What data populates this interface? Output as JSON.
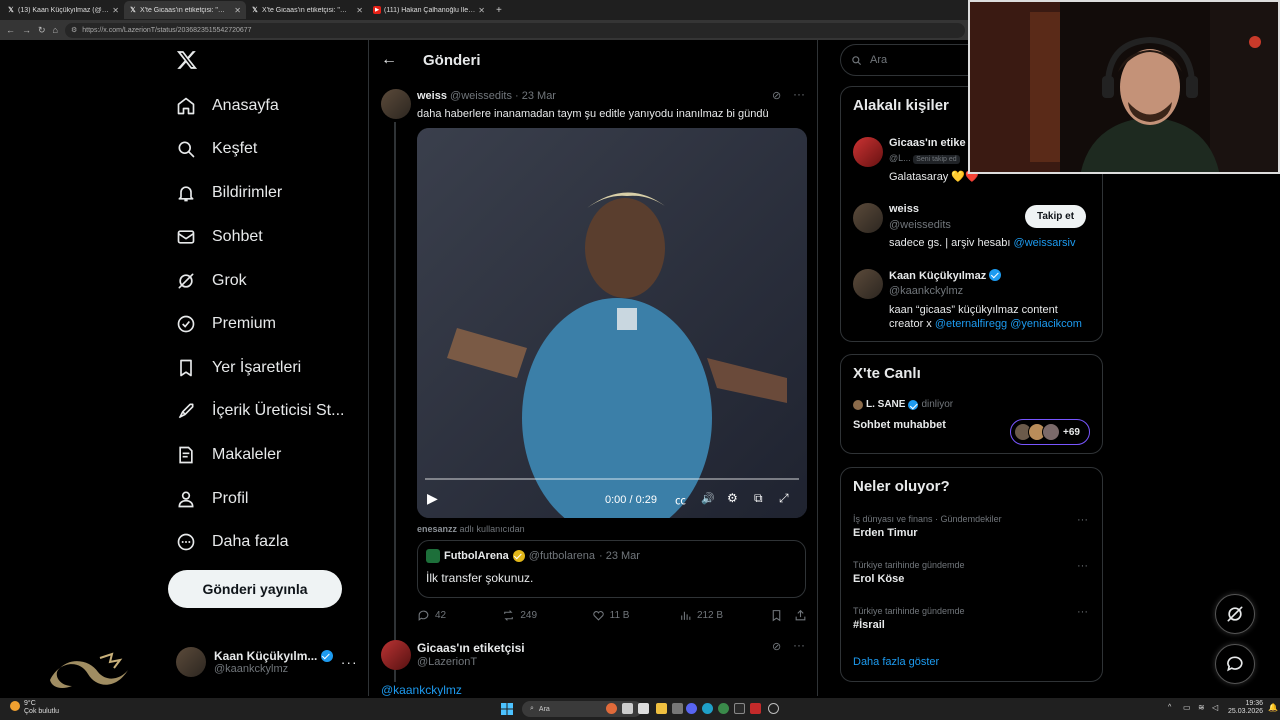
{
  "browser": {
    "tabs": [
      {
        "title": "(13) Kaan Küçükyılmaz (@kaankc",
        "favicon": "X",
        "active": false
      },
      {
        "title": "X'te Gicaas'ın etiketçisi: \"@weisse",
        "favicon": "X",
        "active": true
      },
      {
        "title": "X'te Gicaas'ın etiketçisi: \"@atavrat",
        "favicon": "X",
        "active": false
      },
      {
        "title": "(111) Hakan Çalhanoğlu İle Milan",
        "favicon": "youtube",
        "active": false
      }
    ],
    "new_tab": "+",
    "url": "https://x.com/LazerionT/status/2036823515542720677"
  },
  "nav": {
    "items": [
      {
        "label": "Anasayfa",
        "icon": "home-icon"
      },
      {
        "label": "Keşfet",
        "icon": "search-icon"
      },
      {
        "label": "Bildirimler",
        "icon": "bell-icon"
      },
      {
        "label": "Sohbet",
        "icon": "mail-icon"
      },
      {
        "label": "Grok",
        "icon": "grok-icon"
      },
      {
        "label": "Premium",
        "icon": "premium-icon"
      },
      {
        "label": "Yer İşaretleri",
        "icon": "bookmark-icon"
      },
      {
        "label": "İçerik Üreticisi St...",
        "icon": "rocket-icon"
      },
      {
        "label": "Makaleler",
        "icon": "article-icon"
      },
      {
        "label": "Profil",
        "icon": "profile-icon"
      },
      {
        "label": "Daha fazla",
        "icon": "more-circle-icon"
      }
    ],
    "post_button": "Gönderi yayınla",
    "account": {
      "name": "Kaan Küçükyılm...",
      "handle": "@kaankckylmz"
    }
  },
  "main": {
    "header_title": "Gönderi",
    "tweet": {
      "name": "weiss",
      "handle": "@weissedits",
      "date": "· 23 Mar",
      "text": "daha haberlere inanamadan taym şu editle yanıyodu inanılmaz bi gündü",
      "video": {
        "time": "0:00 / 0:29",
        "progress": 0
      },
      "from_user": "enesanzz",
      "from_suffix": "adlı kullanıcıdan",
      "quote": {
        "name": "FutbolArena",
        "handle": "@futbolarena",
        "date": "· 23 Mar",
        "text": "İlk transfer şokunuz."
      },
      "stats": {
        "replies": "42",
        "reposts": "249",
        "likes": "11 B",
        "views": "212 B"
      }
    },
    "reply": {
      "name": "Gicaas'ın etiketçisi",
      "handle": "@LazerionT",
      "text": "@kaankckylmz"
    }
  },
  "right": {
    "search_placeholder": "Ara",
    "people_title": "Alakalı kişiler",
    "people": [
      {
        "name": "Gicaas'ın etike",
        "handle": "@L...",
        "badge": "Seni takip ed",
        "bio": "Galatasaray 💛❤️"
      },
      {
        "name": "weiss",
        "handle": "@weissedits",
        "follow": "Takip et",
        "bio": "sadece gs. | arşiv hesabı ",
        "bio_link": "@weissarsiv"
      },
      {
        "name": "Kaan Küçükyılmaz",
        "handle": "@kaankckylmz",
        "bio": "kaan “gicaas” küçükyılmaz content creator x ",
        "bio_link1": "@eternalfiregg",
        "bio_link2": "@yeniacikcom"
      }
    ],
    "live_title": "X'te Canlı",
    "live": {
      "host": "L. SANE",
      "status": "dinliyor",
      "title": "Sohbet muhabbet",
      "count": "+69"
    },
    "trends_title": "Neler oluyor?",
    "trends": [
      {
        "context": "İş dünyası ve finans · Gündemdekiler",
        "name": "Erden Timur"
      },
      {
        "context": "Türkiye tarihinde gündemde",
        "name": "Erol Köse"
      },
      {
        "context": "Türkiye tarihinde gündemde",
        "name": "#İsrail"
      }
    ],
    "show_more": "Daha fazla göster"
  },
  "taskbar": {
    "weather_temp": "9°C",
    "weather_text": "Çok bulutlu",
    "search": "Ara",
    "time": "19:36",
    "date": "25.03.2026"
  }
}
